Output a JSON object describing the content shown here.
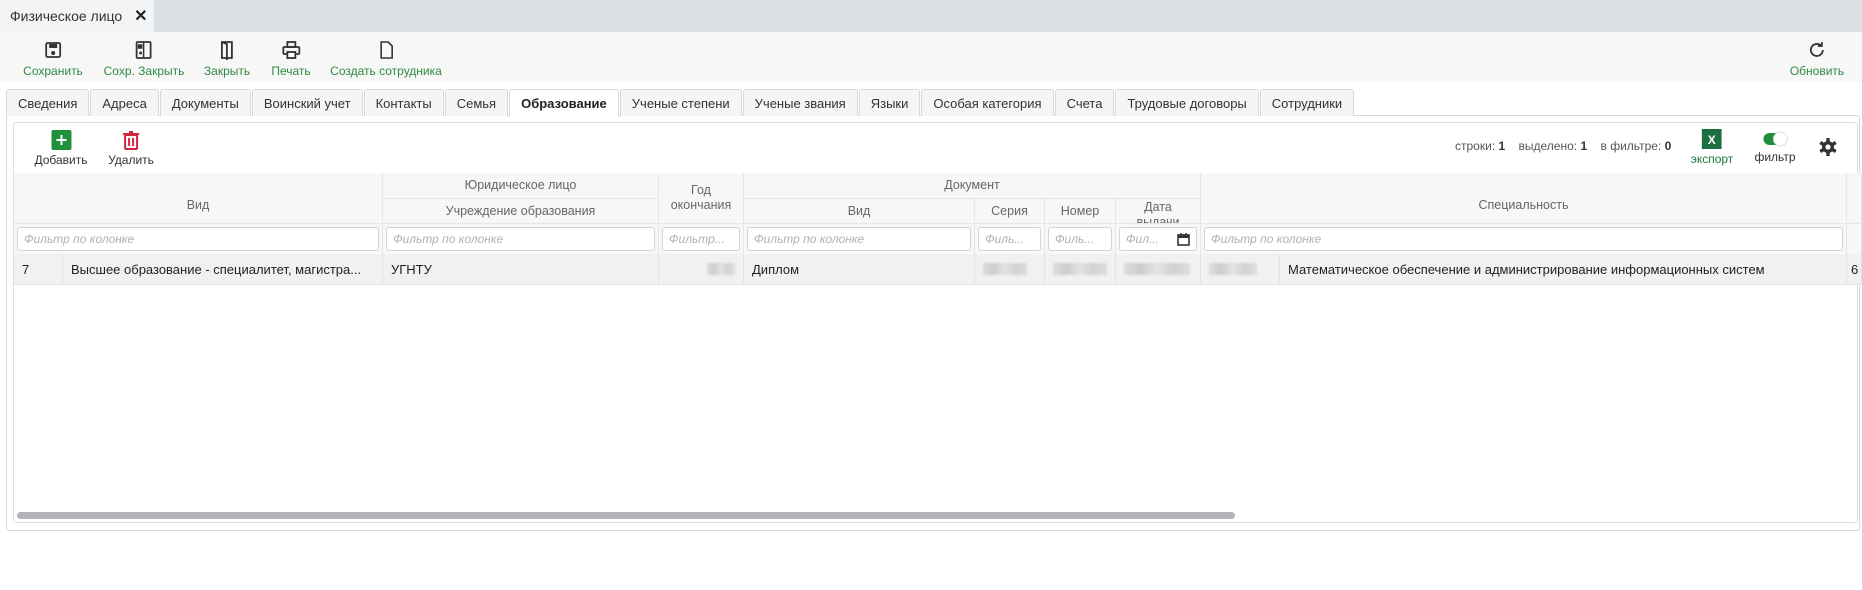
{
  "window_tab": {
    "title": "Физическое лицо",
    "close_icon": "close-icon"
  },
  "toolbar": {
    "save": "Сохранить",
    "save_close": "Сохр. Закрыть",
    "close": "Закрыть",
    "print": "Печать",
    "create_employee": "Создать сотрудника",
    "refresh": "Обновить",
    "accent": "#2e8b3e"
  },
  "tabs": [
    "Сведения",
    "Адреса",
    "Документы",
    "Воинский учет",
    "Контакты",
    "Семья",
    "Образование",
    "Ученые степени",
    "Ученые звания",
    "Языки",
    "Особая категория",
    "Счета",
    "Трудовые договоры",
    "Сотрудники"
  ],
  "active_tab": "Образование",
  "grid_toolbar": {
    "add": "Добавить",
    "delete": "Удалить",
    "export": "экспорт",
    "filter": "фильтр",
    "filter_enabled": true
  },
  "stats": {
    "rows_label": "строки:",
    "rows": "1",
    "selected_label": "выделено:",
    "selected": "1",
    "in_filter_label": "в фильтре:",
    "in_filter": "0"
  },
  "columns": {
    "vid": "Вид",
    "legal_group": "Юридическое лицо",
    "institution": "Учреждение образования",
    "year": "Год окончания",
    "doc_group": "Документ",
    "doc_vid": "Вид",
    "series": "Серия",
    "number": "Номер",
    "issue_date": "Дата выдачи",
    "specialty": "Специальность"
  },
  "filters": {
    "placeholder": "Фильтр по колонке",
    "placeholder_short": "Фильтр...",
    "placeholder_shorter": "Филь...",
    "placeholder_date": "Фил..."
  },
  "rows": [
    {
      "num": "7",
      "vid": "Высшее образование - специалитет, магистра...",
      "institution": "УГНТУ",
      "doc_vid": "Диплом",
      "specialty": "Математическое обеспечение и администрирование информационных систем",
      "next": "6"
    }
  ]
}
